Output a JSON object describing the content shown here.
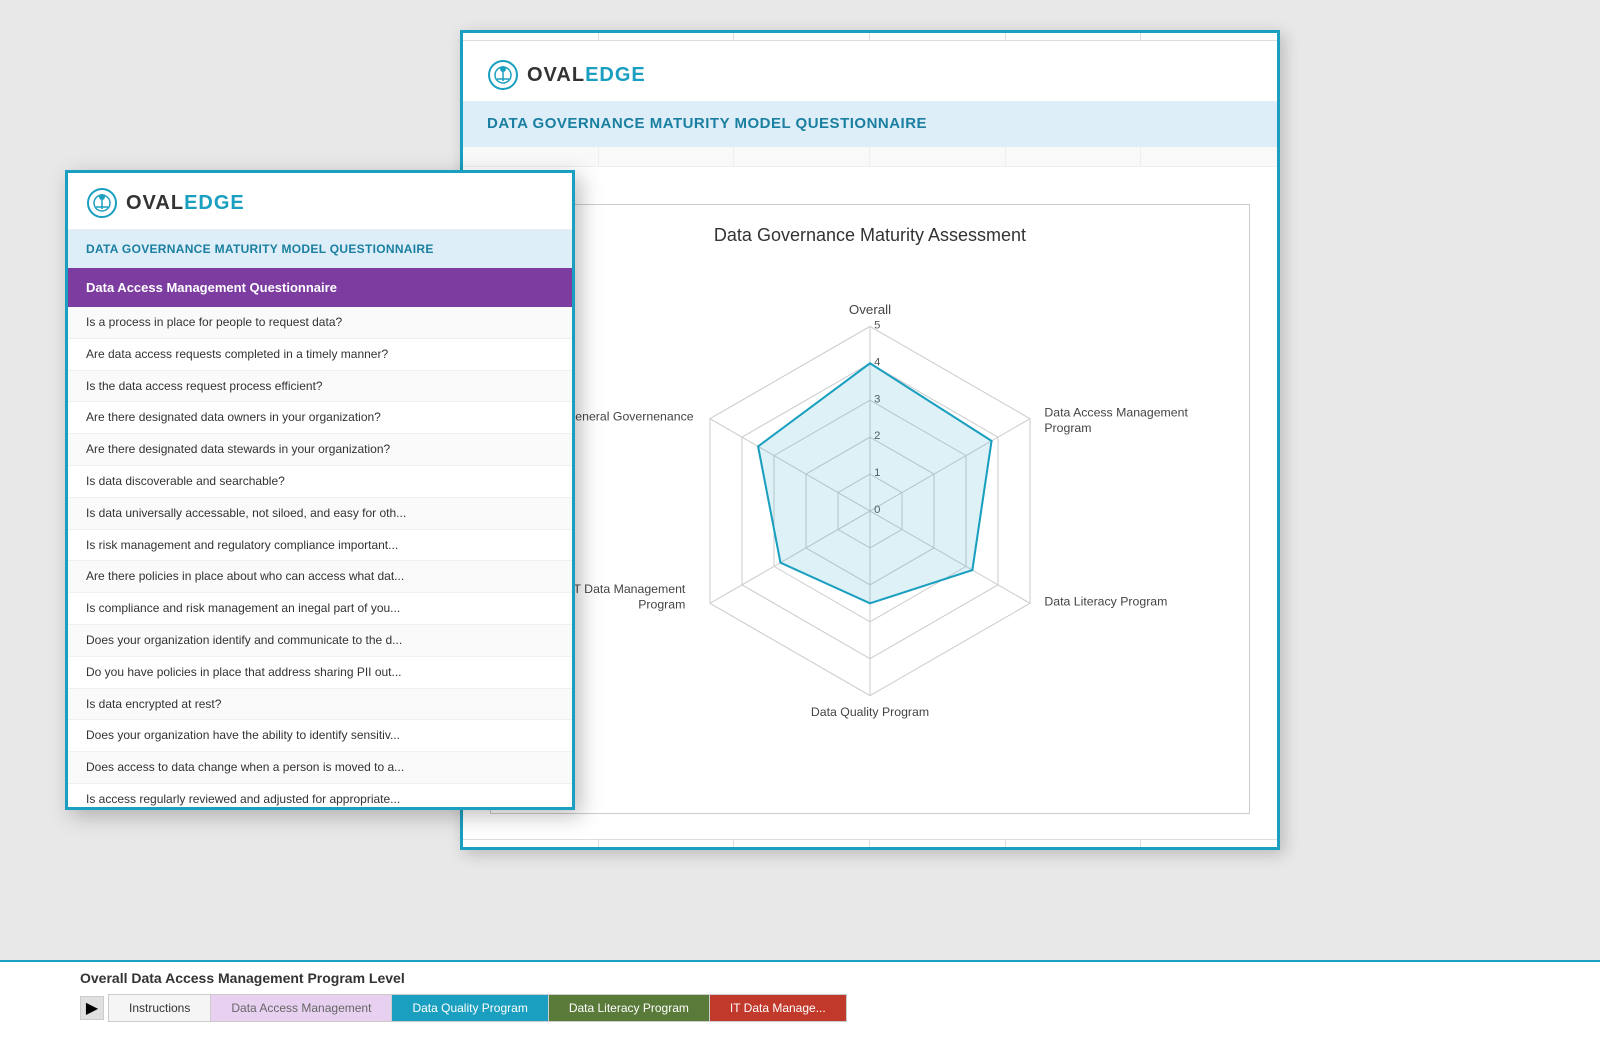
{
  "app": {
    "logo": "OvalEdge",
    "logo_oval": "OVAL",
    "logo_edge": "EDGE"
  },
  "back_card": {
    "title": "DATA GOVERNANCE MATURITY MODEL QUESTIONNAIRE",
    "radar": {
      "title": "Data Governance Maturity Assessment",
      "axes": [
        "Overall",
        "Data Access Management Program",
        "Data Literacy Program",
        "Data Quality Program",
        "IT Data Management Program",
        "General Governenance"
      ],
      "scale": [
        0,
        1,
        2,
        3,
        4,
        5
      ],
      "values": [
        4,
        3.8,
        3.2,
        2.5,
        2.8,
        3.5
      ]
    }
  },
  "front_card": {
    "title": "DATA GOVERNANCE MATURITY MODEL QUESTIONNAIRE",
    "section": "Data Access Management Questionnaire",
    "questions": [
      "Is a process in place for people to request data?",
      "Are data access requests completed in a timely manner?",
      "Is the data access request process efficient?",
      "Are there designated data owners in your organization?",
      "Are there designated data stewards in your organization?",
      "Is data discoverable and searchable?",
      "Is data universally accessable, not siloed, and easy for oth...",
      "Is risk management and regulatory compliance important...",
      "Are there policies in place about who can access what dat...",
      "Is compliance and risk management an inegal part of you...",
      "Does your organization identify and communicate to the d...",
      "Do you have policies in place that address sharing PII out...",
      "Is data encrypted at rest?",
      "Does your organization have the ability to identify sensitiv...",
      "Does access to data change when a person is moved to a...",
      "Is access regularly reviewed and adjusted for appropriate..."
    ]
  },
  "bottom_bar": {
    "section_label": "Overall Data Access Management Program Level",
    "tabs": [
      {
        "label": "Instructions",
        "class": "tab-instructions"
      },
      {
        "label": "Data Access Management",
        "class": "tab-dam"
      },
      {
        "label": "Data Quality Program",
        "class": "tab-dqp"
      },
      {
        "label": "Data Literacy Program",
        "class": "tab-dlp"
      },
      {
        "label": "IT Data Manage...",
        "class": "tab-itdm"
      }
    ]
  }
}
